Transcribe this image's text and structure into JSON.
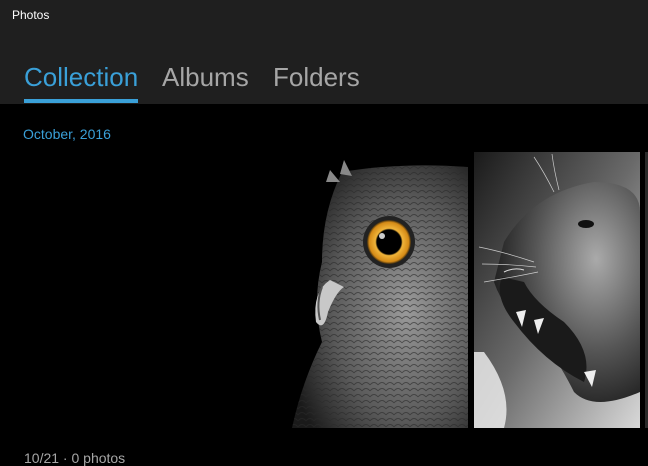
{
  "app": {
    "title": "Photos"
  },
  "tabs": [
    {
      "label": "Collection",
      "active": true
    },
    {
      "label": "Albums",
      "active": false
    },
    {
      "label": "Folders",
      "active": false
    }
  ],
  "collection": {
    "groups": [
      {
        "date_label": "October, 2016",
        "photos": [
          {
            "subject": "owl"
          },
          {
            "subject": "lioness"
          }
        ]
      }
    ],
    "next_group_label": "10/21 · 0 photos"
  },
  "colors": {
    "accent": "#3aa0d8",
    "titlebar_bg": "#1f1f1f",
    "content_bg": "#000000",
    "inactive_tab": "#a6a6a6"
  }
}
